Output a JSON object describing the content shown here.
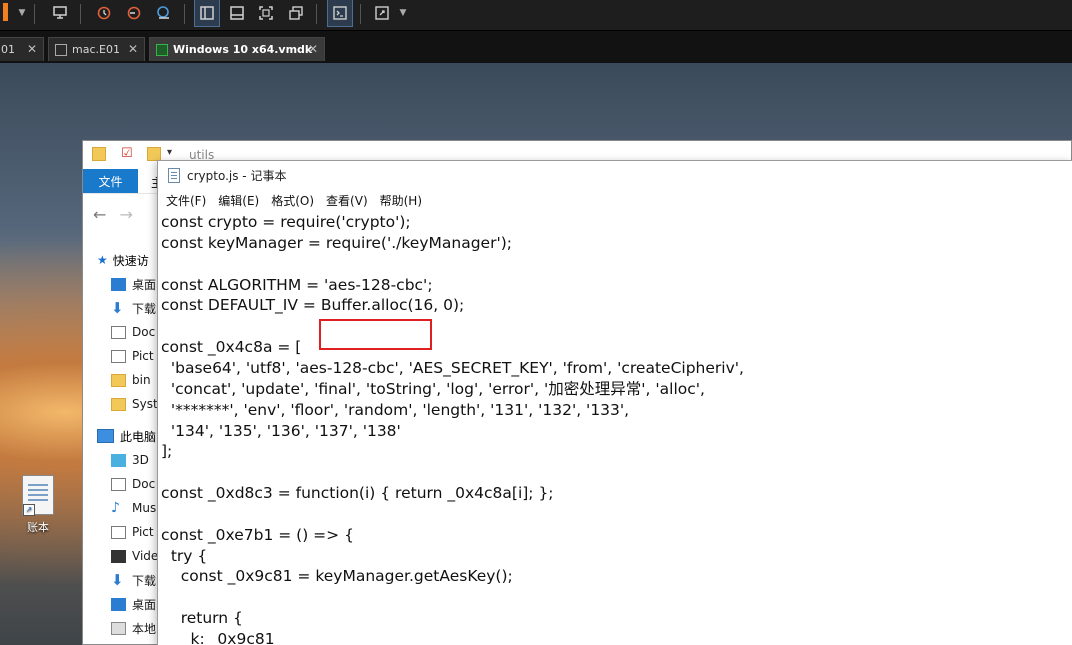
{
  "vm": {
    "tabs": [
      {
        "label": "01",
        "active": false
      },
      {
        "label": "mac.E01",
        "active": false
      },
      {
        "label": "Windows 10 x64.vmdk",
        "active": true
      }
    ],
    "toolbar_icons": [
      "stop-icon",
      "print-icon",
      "snapshot-icon",
      "revert-snapshot-icon",
      "snapshot-manager-icon",
      "single-window-icon",
      "tabs-view-icon",
      "fit-icon",
      "unity-icon",
      "console-icon",
      "fullscreen-icon"
    ],
    "accent_color": "#f08020"
  },
  "desktop": {
    "icon_label": "账本"
  },
  "explorer": {
    "address": "utils",
    "file_tab": "文件",
    "ribbon_partial": "主",
    "nav": {
      "quick_access": "快速访",
      "items_quick": [
        "桌面",
        "下载",
        "Doc",
        "Pict",
        "bin",
        "Syst"
      ],
      "this_pc": "此电脑",
      "items_pc": [
        "3D ",
        "Doc",
        "Mus",
        "Pict",
        "Vide",
        "下载",
        "桌面",
        "本地"
      ]
    }
  },
  "notepad": {
    "title": "crypto.js - 记事本",
    "menu": [
      "文件(F)",
      "编辑(E)",
      "格式(O)",
      "查看(V)",
      "帮助(H)"
    ],
    "lines": [
      "const crypto = require('crypto');",
      "const keyManager = require('./keyManager');",
      "",
      "const ALGORITHM = 'aes-128-cbc';",
      "const DEFAULT_IV = Buffer.alloc(16, 0);",
      "",
      "const _0x4c8a = [",
      "  'base64', 'utf8', 'aes-128-cbc', 'AES_SECRET_KEY', 'from', 'createCipheriv',",
      "  'concat', 'update', 'final', 'toString', 'log', 'error', '加密处理异常', 'alloc',",
      "  '*******', 'env', 'floor', 'random', 'length', '131', '132', '133',",
      "  '134', '135', '136', '137', '138'",
      "];",
      "",
      "const _0xd8c3 = function(i) { return _0x4c8a[i]; };",
      "",
      "const _0xe7b1 = () => {",
      "  try {",
      "    const _0x9c81 = keyManager.getAesKey();",
      "",
      "    return {",
      "      k: _0x9c81"
    ]
  }
}
